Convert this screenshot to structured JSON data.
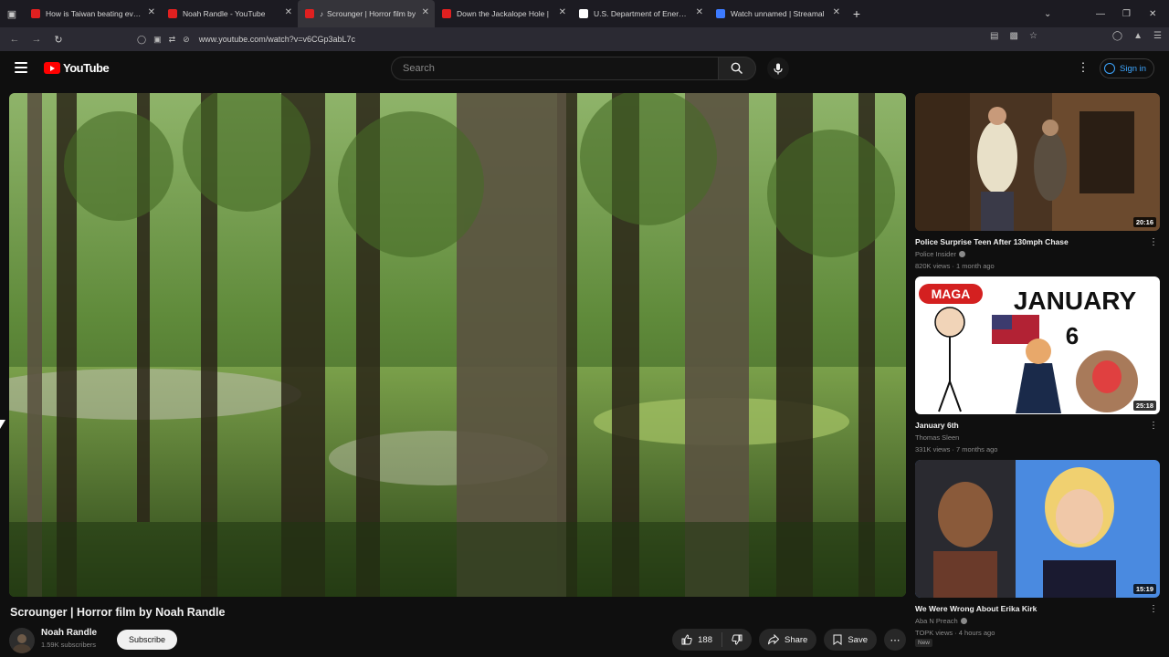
{
  "browser": {
    "tabs": [
      {
        "title": "How is Taiwan beating everyon",
        "color": "#e02020",
        "active": false
      },
      {
        "title": "Noah Randle - YouTube",
        "color": "#e02020",
        "active": false
      },
      {
        "title": "Scrounger | Horror film by",
        "color": "#e02020",
        "active": true
      },
      {
        "title": "Down the Jackalope Hole |",
        "color": "#e02020",
        "active": false
      },
      {
        "title": "U.S. Department of Energy on",
        "color": "#ffffff",
        "active": false
      },
      {
        "title": "Watch unnamed | Streamal",
        "color": "#3d7bff",
        "active": false
      }
    ],
    "url": "www.youtube.com/watch?v=v6CGp3abL7c"
  },
  "header": {
    "logo_text": "YouTube",
    "search_placeholder": "Search",
    "signin_label": "Sign in"
  },
  "video": {
    "title": "Scrounger | Horror film by Noah Randle",
    "channel": "Noah Randle",
    "subscribers": "1.59K subscribers",
    "subscribe_label": "Subscribe",
    "likes": "188",
    "share_label": "Share",
    "save_label": "Save"
  },
  "recommendations": [
    {
      "title": "Police Surprise Teen After 130mph Chase",
      "channel": "Police Insider",
      "meta": "820K views · 1 month ago",
      "duration": "20:16",
      "verified": true
    },
    {
      "title": "January 6th",
      "channel": "Thomas Sleen",
      "meta": "331K views · 7 months ago",
      "duration": "25:18",
      "verified": false,
      "thumb_text": {
        "badge": "MAGA",
        "headline": "JANUARY",
        "number": "6"
      }
    },
    {
      "title": "We Were Wrong About Erika Kirk",
      "channel": "Aba N Preach",
      "meta": "TOPK views · 4 hours ago",
      "duration": "15:19",
      "verified": true,
      "badge": "New"
    }
  ],
  "colors": {
    "accent_red": "#ff0000",
    "link_blue": "#3ea6ff",
    "background": "#0f0f0f"
  }
}
